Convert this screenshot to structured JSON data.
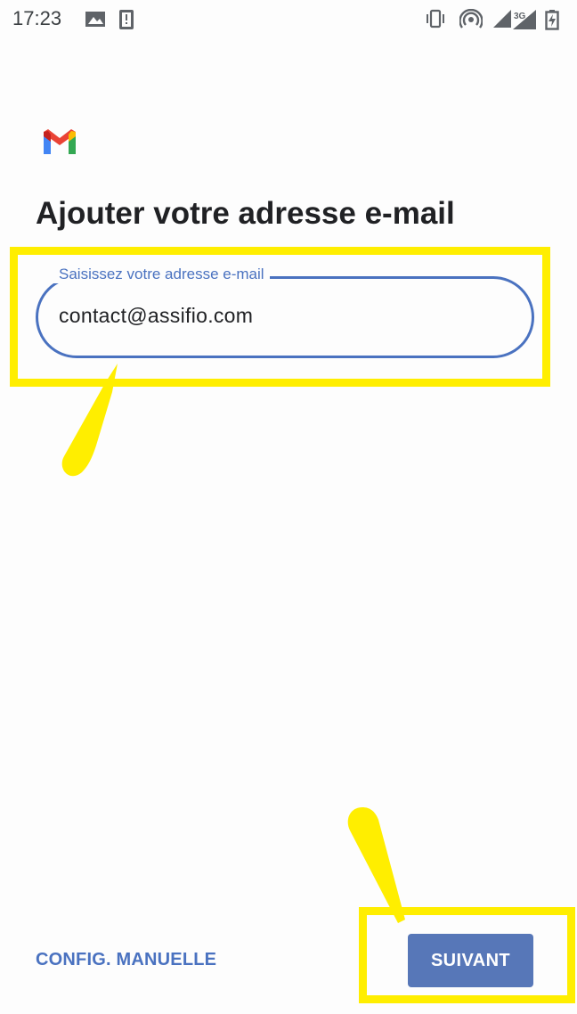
{
  "status_bar": {
    "time": "17:23",
    "left_icons": [
      "gallery-icon",
      "alert-icon"
    ],
    "right_icons": [
      "vibrate-icon",
      "hotspot-icon",
      "signal-icon",
      "signal-3g-icon",
      "battery-charging-icon"
    ],
    "network_label": "3G"
  },
  "logo": {
    "name": "gmail-logo"
  },
  "page": {
    "title": "Ajouter votre adresse e-mail"
  },
  "email_field": {
    "label": "Saisissez votre adresse e-mail",
    "value": "contact@assifio.com"
  },
  "actions": {
    "manual_config_label": "CONFIG. MANUELLE",
    "next_label": "SUIVANT"
  },
  "colors": {
    "accent": "#4a72c0",
    "button": "#5777b8",
    "highlight": "#ffee00"
  }
}
